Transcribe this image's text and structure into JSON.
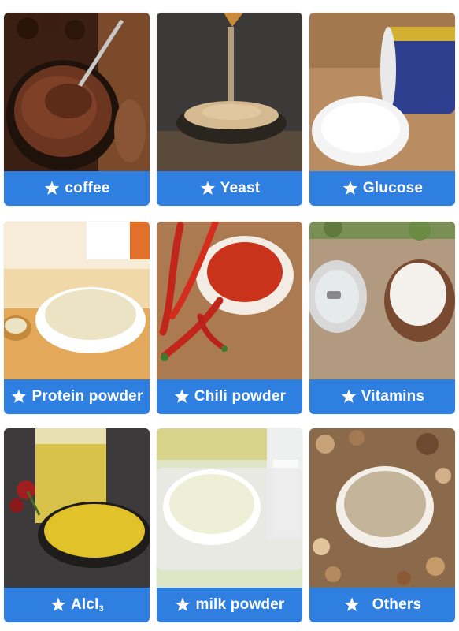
{
  "products": [
    {
      "label": "coffee"
    },
    {
      "label": "Yeast"
    },
    {
      "label": "Glucose"
    },
    {
      "label": "Protein powder"
    },
    {
      "label": "Chili powder"
    },
    {
      "label": "Vitamins"
    },
    {
      "label": "Alcl",
      "subscript": "3"
    },
    {
      "label": "milk powder"
    },
    {
      "label": "Others"
    }
  ],
  "label_bar_color": "#2f7fe0",
  "icon_name": "puzzle-star-icon"
}
